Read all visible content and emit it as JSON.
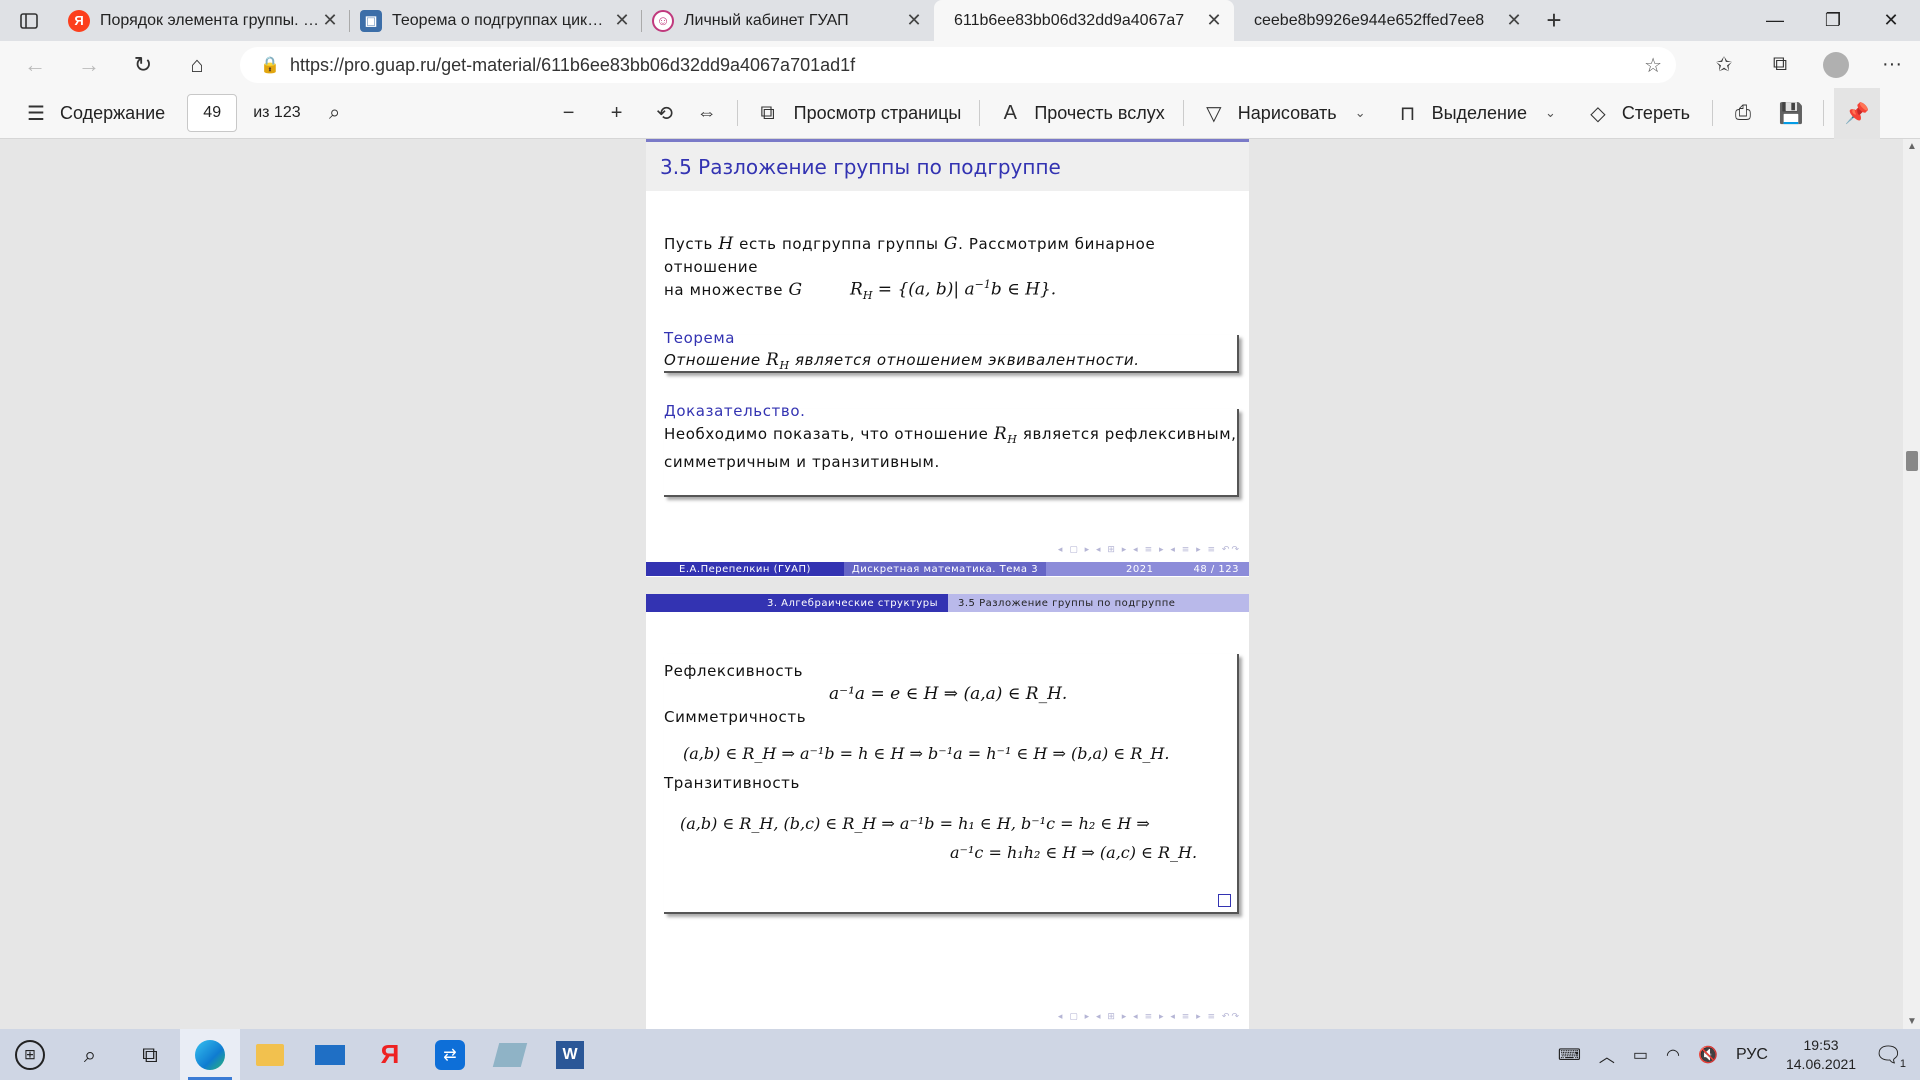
{
  "browser": {
    "tabs": [
      {
        "label": "Порядок элемента группы. Тео",
        "icon": "yandex-favicon",
        "color": "#fc3f1d"
      },
      {
        "label": "Теорема о подгруппах цикличе",
        "icon": "presentation-favicon",
        "color": "#3c6ea8"
      },
      {
        "label": "Личный кабинет ГУАП",
        "icon": "user-favicon",
        "color": "#c0397d"
      },
      {
        "label": "611b6ee83bb06d32dd9a4067a7",
        "icon": "",
        "color": ""
      },
      {
        "label": "ceebe8b9926e944e652ffed7ee8",
        "icon": "",
        "color": ""
      }
    ],
    "active_tab": 3,
    "url": "https://pro.guap.ru/get-material/611b6ee83bb06d32dd9a4067a701ad1f"
  },
  "pdf_toolbar": {
    "contents_label": "Содержание",
    "page_current": "49",
    "page_total": "из 123",
    "page_view_label": "Просмотр страницы",
    "read_aloud_label": "Прочесть вслух",
    "draw_label": "Нарисовать",
    "highlight_label": "Выделение",
    "erase_label": "Стереть"
  },
  "slide1": {
    "title": "3.5 Разложение группы по подгруппе",
    "intro_line1_a": "Пусть ",
    "intro_H": "H",
    "intro_line1_b": " есть подгруппа группы ",
    "intro_G": "G",
    "intro_line1_c": ". Рассмотрим бинарное отношение",
    "intro_line2": "на множестве ",
    "intro_G2": "G",
    "formula": "R_H = {(a,b)| a⁻¹b ∈ H}.",
    "theorem_head": "Теорема",
    "theorem_text_a": "Отношение ",
    "theorem_RH": "R",
    "theorem_H": "H",
    "theorem_text_b": " является отношением эквивалентности.",
    "proof_head": "Доказательство.",
    "proof_line1_a": "Необходимо показать, что отношение ",
    "proof_RH": "R",
    "proof_H": "H",
    "proof_line1_b": " является рефлексивным,",
    "proof_line2": "симметричным и транзитивным.",
    "footer_author": "Е.А.Перепелкин  (ГУАП)",
    "footer_course": "Дискретная математика. Тема 3",
    "footer_year": "2021",
    "footer_page": "48 / 123"
  },
  "slide2": {
    "header_section": "3. Алгебраические структуры",
    "header_subsection": "3.5 Разложение группы по подгруппе",
    "reflexivity_label": "Рефлексивность",
    "reflexivity_formula": "a⁻¹a = e ∈ H  ⇒  (a,a) ∈ R_H.",
    "symmetry_label": "Симметричность",
    "symmetry_formula": "(a,b) ∈ R_H  ⇒  a⁻¹b = h ∈ H ⇒  b⁻¹a = h⁻¹ ∈ H  ⇒  (b,a) ∈ R_H.",
    "transitivity_label": "Транзитивность",
    "transitivity_formula_1": "(a,b) ∈ R_H, (b,c) ∈ R_H  ⇒  a⁻¹b = h₁ ∈ H, b⁻¹c = h₂ ∈ H  ⇒",
    "transitivity_formula_2": "a⁻¹c = h₁h₂ ∈ H  ⇒  (a,c) ∈ R_H."
  },
  "taskbar": {
    "lang": "РУС",
    "time": "19:53",
    "date": "14.06.2021",
    "notif_count": "1"
  },
  "colors": {
    "accent": "#3333b2",
    "beamer_dark": "#3333b2",
    "beamer_light": "#8c8cd9"
  }
}
